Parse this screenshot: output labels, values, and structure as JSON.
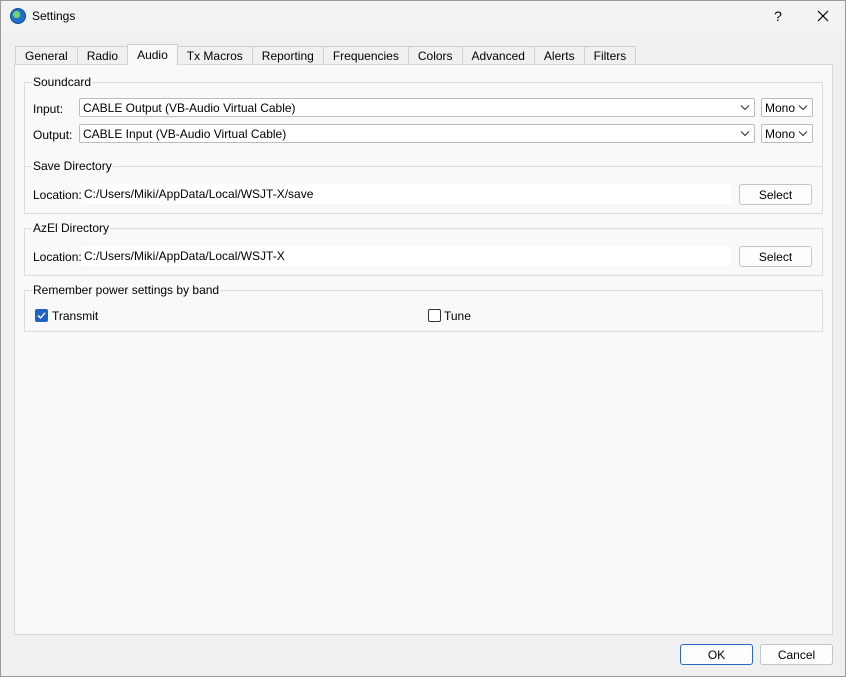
{
  "window": {
    "title": "Settings",
    "help_label": "?"
  },
  "tabs": [
    {
      "label": "General"
    },
    {
      "label": "Radio"
    },
    {
      "label": "Audio",
      "active": true
    },
    {
      "label": "Tx Macros"
    },
    {
      "label": "Reporting"
    },
    {
      "label": "Frequencies"
    },
    {
      "label": "Colors"
    },
    {
      "label": "Advanced"
    },
    {
      "label": "Alerts"
    },
    {
      "label": "Filters"
    }
  ],
  "soundcard": {
    "title": "Soundcard",
    "input_label": "Input:",
    "input_value": "CABLE Output (VB-Audio Virtual Cable)",
    "input_channel": "Mono",
    "output_label": "Output:",
    "output_value": "CABLE Input (VB-Audio Virtual Cable)",
    "output_channel": "Mono"
  },
  "save_directory": {
    "title": "Save Directory",
    "location_label": "Location:",
    "path": "C:/Users/Miki/AppData/Local/WSJT-X/save",
    "select_label": "Select"
  },
  "azel_directory": {
    "title": "AzEl Directory",
    "location_label": "Location:",
    "path": "C:/Users/Miki/AppData/Local/WSJT-X",
    "select_label": "Select"
  },
  "power_settings": {
    "title": "Remember power settings by band",
    "transmit_label": "Transmit",
    "transmit_checked": true,
    "tune_label": "Tune",
    "tune_checked": false
  },
  "footer": {
    "ok_label": "OK",
    "cancel_label": "Cancel"
  },
  "colors": {
    "accent": "#1f64c4"
  }
}
